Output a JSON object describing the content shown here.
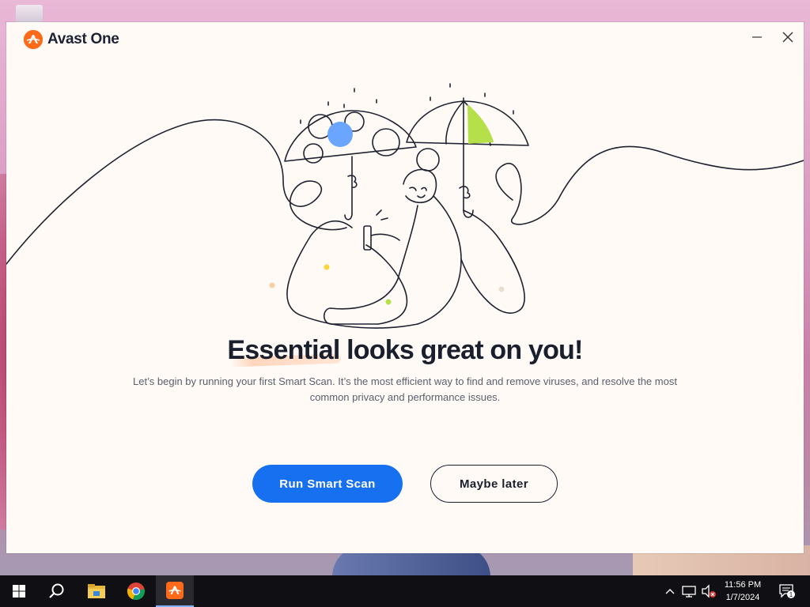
{
  "app": {
    "name": "Avast One",
    "brand_color": "#ff6a1a",
    "accent_color": "#1670f0"
  },
  "window_controls": {
    "minimize_icon": "minimize-icon",
    "close_icon": "close-icon"
  },
  "main": {
    "headline": "Essential looks great on you!",
    "description": "Let’s begin by running your first Smart Scan. It’s the most efficient way to find and remove viruses, and resolve the most common privacy and performance issues.",
    "primary_button": "Run Smart Scan",
    "secondary_button": "Maybe later"
  },
  "taskbar": {
    "items": [
      {
        "icon": "windows-start-icon"
      },
      {
        "icon": "search-icon"
      },
      {
        "icon": "file-explorer-icon"
      },
      {
        "icon": "chrome-icon"
      },
      {
        "icon": "avast-icon",
        "active": true
      }
    ],
    "tray": {
      "icons": [
        "chevron-up-icon",
        "network-icon",
        "volume-muted-icon",
        "notification-icon"
      ],
      "notification_count": "1",
      "time": "11:56 PM",
      "date": "1/7/2024"
    }
  }
}
